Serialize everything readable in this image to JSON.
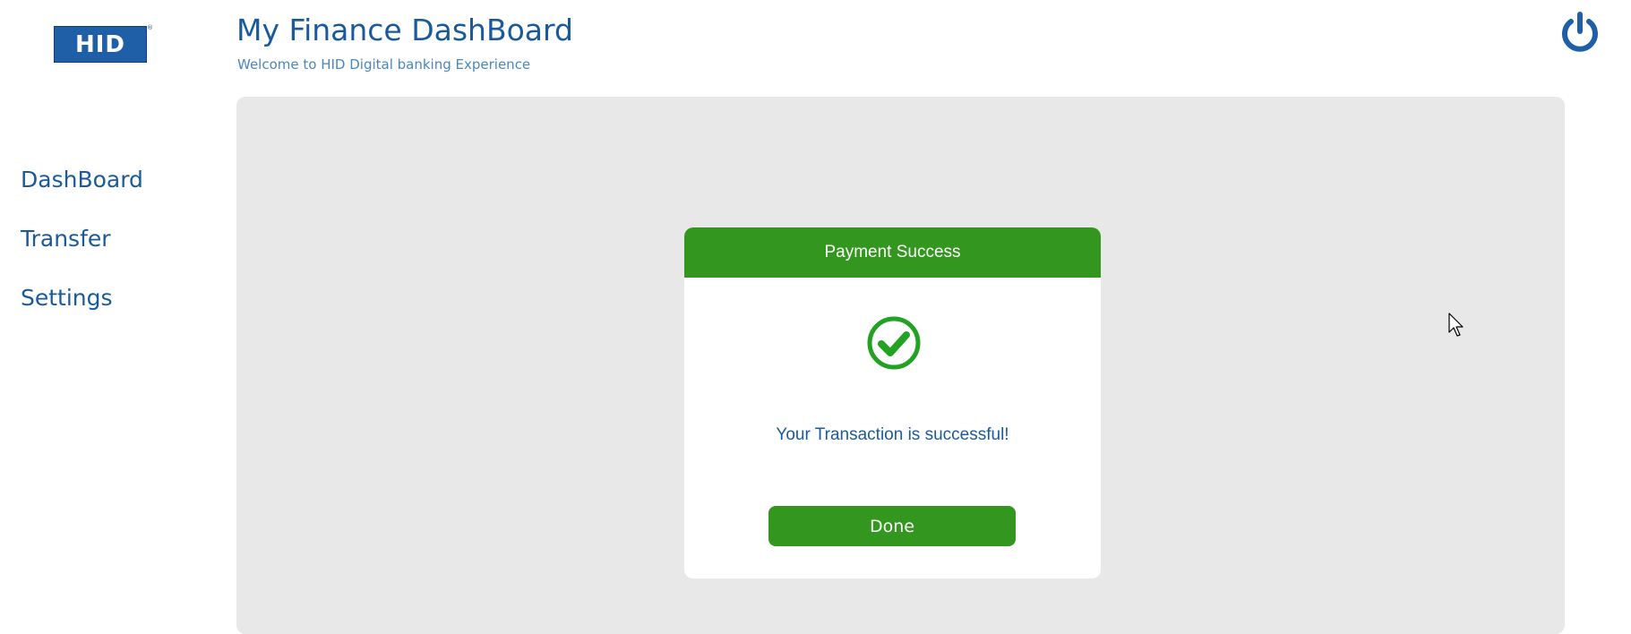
{
  "brand": {
    "logo_text": "HID",
    "logo_mark": "®",
    "color": "#1f5fa8"
  },
  "header": {
    "title": "My Finance DashBoard",
    "subtitle": "Welcome to HID Digital banking Experience",
    "power_icon": "power-icon"
  },
  "sidebar": {
    "items": [
      {
        "label": "DashBoard"
      },
      {
        "label": "Transfer"
      },
      {
        "label": "Settings"
      }
    ]
  },
  "modal": {
    "title": "Payment Success",
    "icon": "check-circle-icon",
    "message": "Your Transaction is successful!",
    "done_label": "Done",
    "accent_color": "#33961f"
  },
  "colors": {
    "primary_text": "#1a5a9c",
    "panel_background": "#e8e8e8",
    "success": "#33961f"
  }
}
